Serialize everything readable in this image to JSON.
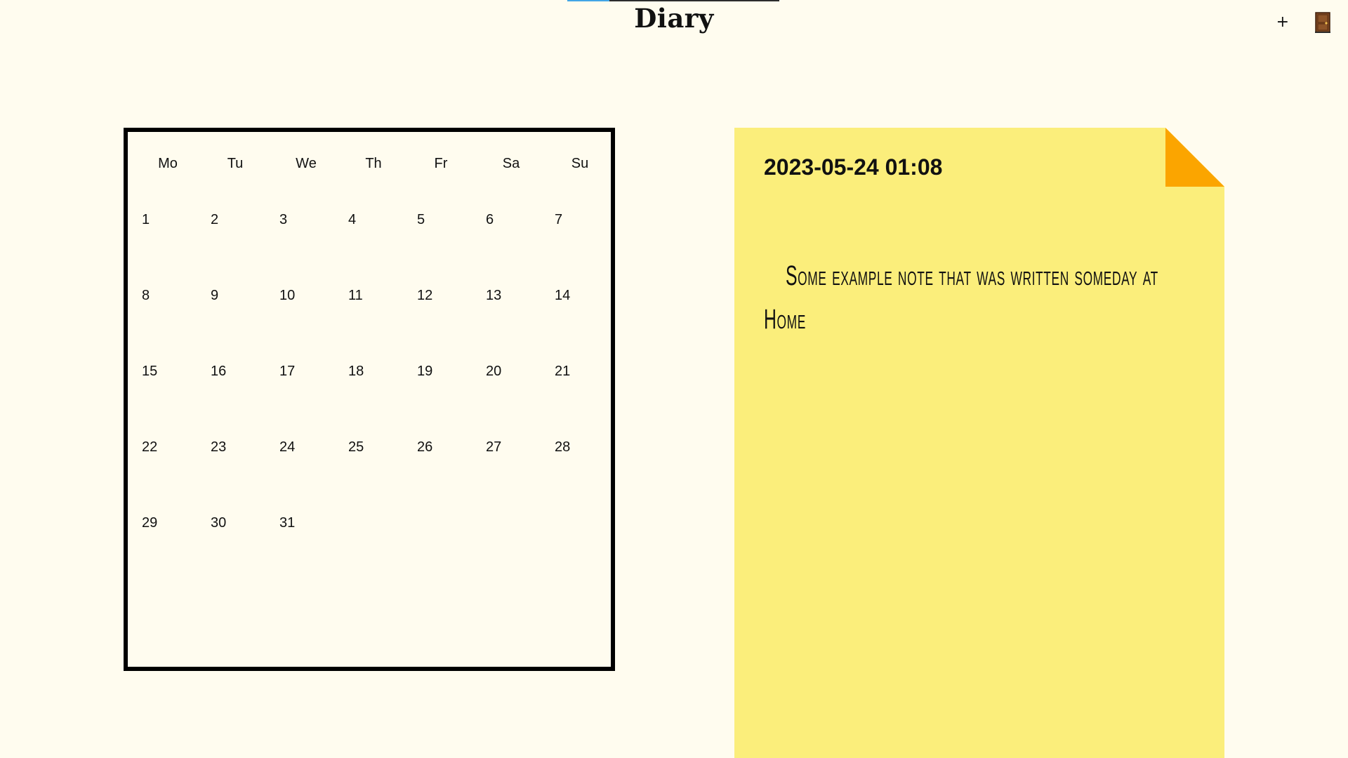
{
  "app": {
    "title": "Diary",
    "progress": 0.2
  },
  "toolbar": {
    "add_label": "+",
    "exit_icon": "door-icon"
  },
  "calendar": {
    "weekdays": [
      "Mo",
      "Tu",
      "We",
      "Th",
      "Fr",
      "Sa",
      "Su"
    ],
    "days": [
      "1",
      "2",
      "3",
      "4",
      "5",
      "6",
      "7",
      "8",
      "9",
      "10",
      "11",
      "12",
      "13",
      "14",
      "15",
      "16",
      "17",
      "18",
      "19",
      "20",
      "21",
      "22",
      "23",
      "24",
      "25",
      "26",
      "27",
      "28",
      "29",
      "30",
      "31"
    ],
    "first_weekday_index": 0
  },
  "note": {
    "datetime": "2023-05-24 01:08",
    "text": "Some example note that was written someday at Home",
    "colors": {
      "paper": "#fbee7b",
      "fold": "#fba500"
    }
  }
}
